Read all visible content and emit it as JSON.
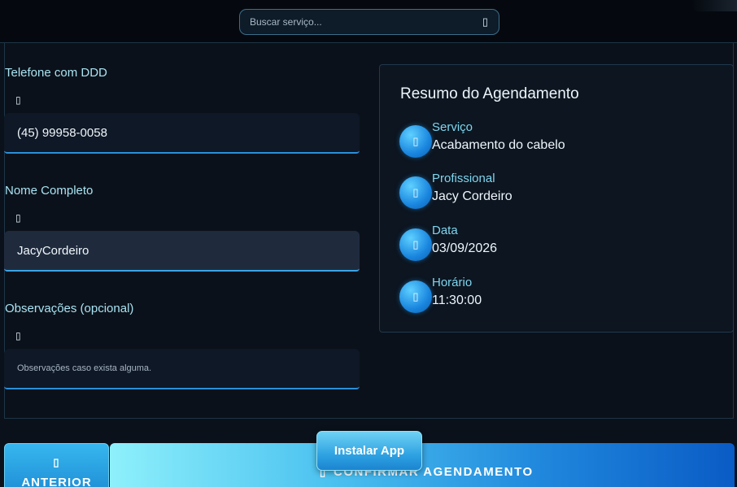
{
  "header": {
    "search": {
      "placeholder": "Buscar serviço...",
      "icon": "search-icon"
    }
  },
  "form": {
    "phone": {
      "label": "Telefone com DDD",
      "icon": "phone-icon",
      "value": "(45) 99958-0058"
    },
    "name": {
      "label": "Nome Completo",
      "icon": "user-icon",
      "value": "JacyCordeiro"
    },
    "notes": {
      "label": "Observações (opcional)",
      "icon": "comment-icon",
      "placeholder": "Observações caso exista alguma."
    }
  },
  "summary": {
    "title": "Resumo do Agendamento",
    "items": [
      {
        "icon": "scissors-icon",
        "label": "Serviço",
        "value": "Acabamento do cabelo"
      },
      {
        "icon": "user-tie-icon",
        "label": "Profissional",
        "value": "Jacy Cordeiro"
      },
      {
        "icon": "calendar-icon",
        "label": "Data",
        "value": "03/09/2026"
      },
      {
        "icon": "clock-icon",
        "label": "Horário",
        "value": "11:30:00"
      }
    ]
  },
  "footer": {
    "prev": {
      "label": "ANTERIOR",
      "icon": "arrow-left-icon"
    },
    "confirm": {
      "label": "CONFIRMAR AGENDAMENTO",
      "icon": "check-icon"
    },
    "install": {
      "label": "Instalar App"
    }
  },
  "colors": {
    "background": "#0b111a",
    "accent": "#2a8ed8",
    "label": "#a9e3f3"
  }
}
